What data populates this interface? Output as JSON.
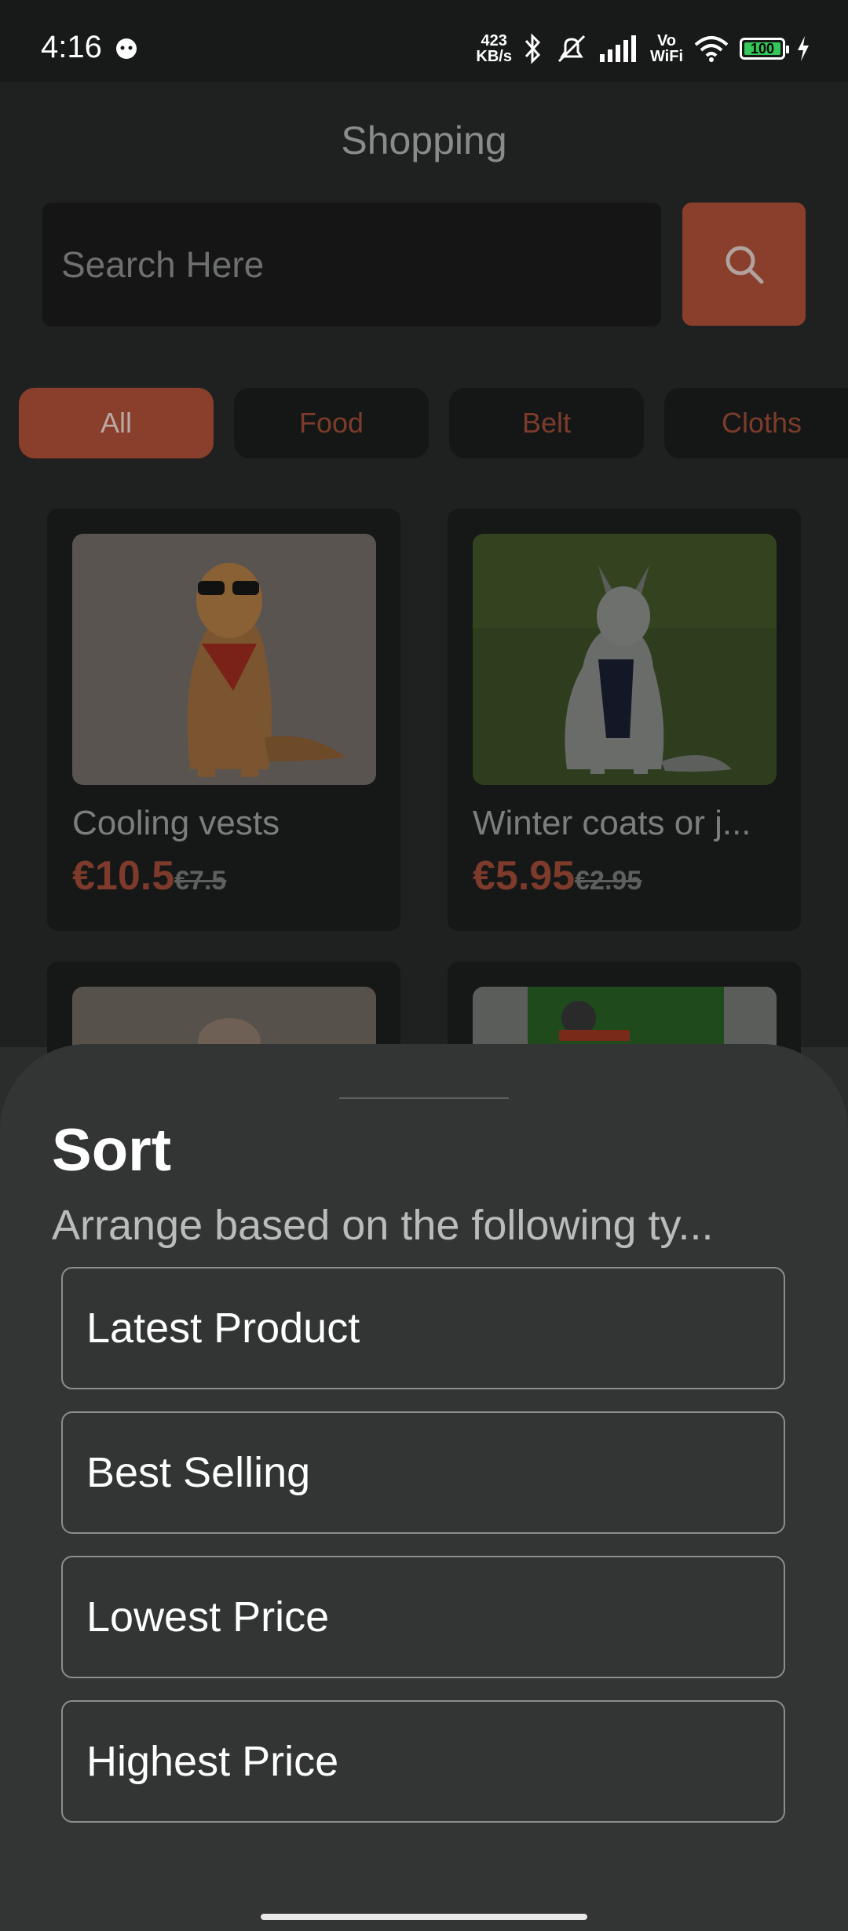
{
  "status_bar": {
    "time": "4:16",
    "net_speed_value": "423",
    "net_speed_unit": "KB/s",
    "vo": "Vo",
    "wifi_label": "WiFi",
    "battery": "100"
  },
  "header": {
    "title": "Shopping"
  },
  "search": {
    "placeholder": "Search Here"
  },
  "categories": [
    "All",
    "Food",
    "Belt",
    "Cloths"
  ],
  "products": [
    {
      "name": "Cooling vests",
      "price": "€10.5",
      "old_price": "€7.5"
    },
    {
      "name": "Winter coats or j...",
      "price": "€5.95",
      "old_price": "€2.95"
    }
  ],
  "sheet": {
    "title": "Sort",
    "subtitle": "Arrange based on the following ty...",
    "options": [
      "Latest Product",
      "Best Selling",
      "Lowest Price",
      "Highest Price"
    ]
  },
  "colors": {
    "accent": "#c0563c",
    "background": "#2b2d2c",
    "sheet": "#323534"
  }
}
